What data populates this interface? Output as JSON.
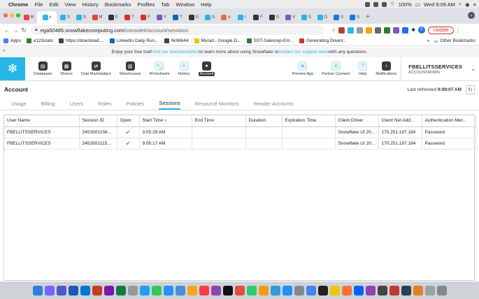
{
  "menubar": {
    "app": "Chrome",
    "items": [
      "File",
      "Edit",
      "View",
      "History",
      "Bookmarks",
      "Profiles",
      "Tab",
      "Window",
      "Help"
    ],
    "battery": "100%",
    "clock": "Wed 9:09 AM"
  },
  "tabs": [
    "M",
    "x",
    "S",
    "S",
    "M",
    "E",
    "T",
    "F",
    "Y",
    "T",
    "G",
    "G",
    "e",
    "I",
    "F",
    "G",
    "V",
    "S",
    "D",
    "S",
    "S"
  ],
  "address": {
    "host": "ega50485.snowflakecomputing.com",
    "path": "/console#/account/sessions",
    "update_label": "Update",
    "profile_initial": "F"
  },
  "bookmarks": {
    "items": [
      "Apps",
      "e123stats",
      "https://download....",
      "LinkedIn Daily Run...",
      "hk96644",
      "Murad - Google D...",
      "SST-Salesrep-Em...",
      "Generating Downl..."
    ],
    "more": "»",
    "other": "Other Bookmarks"
  },
  "banner": {
    "lead": "Enjoy your free trial! ",
    "link1": "Visit our documentation",
    "mid": " to learn more about using Snowflake or ",
    "link2": "contact our support team",
    "tail": " with any questions."
  },
  "sfnav": {
    "items": [
      {
        "label": "Databases",
        "icon": "database-icon"
      },
      {
        "label": "Shares",
        "icon": "shares-icon"
      },
      {
        "label": "Data Marketplace",
        "icon": "marketplace-icon"
      },
      {
        "label": "Warehouses",
        "icon": "warehouse-icon"
      },
      {
        "label": "Worksheets",
        "icon": "worksheet-icon"
      },
      {
        "label": "History",
        "icon": "history-icon"
      },
      {
        "label": "Account",
        "icon": "account-icon"
      }
    ],
    "right_items": [
      {
        "label": "Preview App",
        "icon": "preview-app-icon"
      },
      {
        "label": "Partner Connect",
        "icon": "partner-connect-icon"
      },
      {
        "label": "Help",
        "icon": "help-icon"
      },
      {
        "label": "Notifications",
        "icon": "notifications-icon"
      }
    ],
    "account_name": "FBELLITSSERVICES",
    "account_role": "ACCOUNTADMIN"
  },
  "page": {
    "title": "Account",
    "refresh_label": "Last refreshed ",
    "refresh_time": "9:09:07 AM"
  },
  "subtabs": [
    "Usage",
    "Billing",
    "Users",
    "Roles",
    "Policies",
    "Sessions",
    "Resource Monitors",
    "Reader Accounts"
  ],
  "table": {
    "columns": [
      "User Name",
      "Session ID",
      "Open",
      "Start Time",
      "End Time",
      "Duration",
      "Expiration Time",
      "Client Driver",
      "Client Net Add...",
      "Authentication Met..."
    ],
    "rows": [
      [
        "FBELLITSSERVICES",
        "2453502156...",
        "✔",
        "9:05:29 AM",
        "",
        "",
        "",
        "Snowflake UI 20...",
        "170.251.197.184",
        "Password"
      ],
      [
        "FBELLITSSERVICES",
        "2453502115...",
        "✔",
        "9:05:17 AM",
        "",
        "",
        "",
        "Snowflake UI 20...",
        "170.251.197.184",
        "Password"
      ]
    ]
  },
  "colors": {
    "snowflake_blue": "#29b5e8",
    "check_green": "#3fae49",
    "update_red": "#d93025"
  }
}
